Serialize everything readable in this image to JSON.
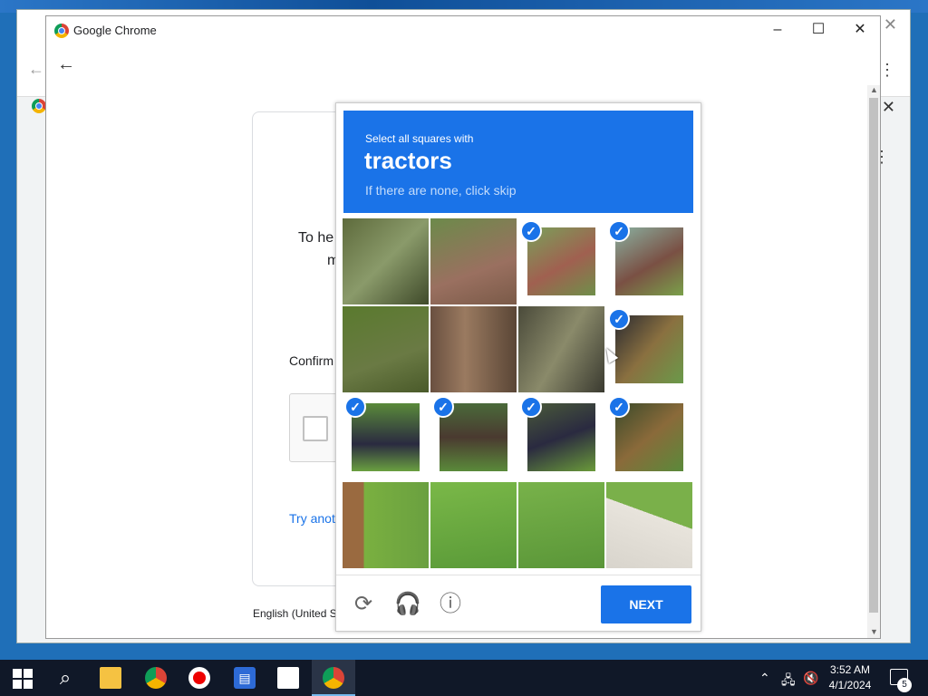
{
  "window": {
    "title": "Google Chrome",
    "minimize": "–",
    "maximize": "☐",
    "close": "✕"
  },
  "page": {
    "heading_line1": "To he",
    "heading_line2": "m",
    "confirm_label": "Confirm",
    "try_another_link": "Try anot",
    "language": "English (United S"
  },
  "captcha": {
    "instruction": "Select all squares with",
    "target": "tractors",
    "hint": "If there are none, click skip",
    "tiles_selected": [
      false,
      false,
      true,
      true,
      false,
      false,
      false,
      true,
      true,
      true,
      true,
      true,
      false,
      false,
      false,
      false
    ],
    "next_label": "NEXT",
    "icons": [
      "reload-icon",
      "audio-icon",
      "info-icon"
    ]
  },
  "taskbar": {
    "time": "3:52 AM",
    "date": "4/1/2024",
    "notification_count": "5"
  },
  "colors": {
    "accent": "#1a73e8",
    "taskbar": "#101828"
  }
}
